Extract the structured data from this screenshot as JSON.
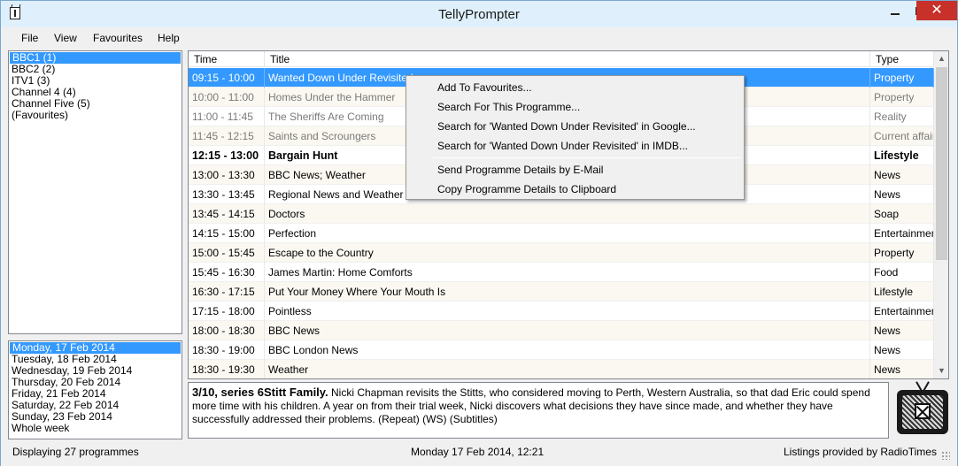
{
  "window": {
    "title": "TellyPrompter"
  },
  "menu": [
    "File",
    "View",
    "Favourites",
    "Help"
  ],
  "channels": [
    {
      "label": "BBC1 (1)",
      "selected": true
    },
    {
      "label": "BBC2 (2)",
      "selected": false
    },
    {
      "label": "ITV1 (3)",
      "selected": false
    },
    {
      "label": "Channel 4 (4)",
      "selected": false
    },
    {
      "label": "Channel Five (5)",
      "selected": false
    },
    {
      "label": "(Favourites)",
      "selected": false
    }
  ],
  "dates": [
    {
      "label": "Monday, 17 Feb 2014",
      "selected": true
    },
    {
      "label": "Tuesday, 18 Feb 2014",
      "selected": false
    },
    {
      "label": "Wednesday, 19 Feb 2014",
      "selected": false
    },
    {
      "label": "Thursday, 20 Feb 2014",
      "selected": false
    },
    {
      "label": "Friday, 21 Feb 2014",
      "selected": false
    },
    {
      "label": "Saturday, 22 Feb 2014",
      "selected": false
    },
    {
      "label": "Sunday, 23 Feb 2014",
      "selected": false
    },
    {
      "label": "Whole week",
      "selected": false
    }
  ],
  "table": {
    "headers": {
      "time": "Time",
      "title": "Title",
      "type": "Type"
    },
    "rows": [
      {
        "time": "09:15 - 10:00",
        "title": "Wanted Down Under Revisited",
        "type": "Property",
        "state": "selected"
      },
      {
        "time": "10:00 - 11:00",
        "title": "Homes Under the Hammer",
        "type": "Property",
        "state": "past"
      },
      {
        "time": "11:00 - 11:45",
        "title": "The Sheriffs Are Coming",
        "type": "Reality",
        "state": "past"
      },
      {
        "time": "11:45 - 12:15",
        "title": "Saints and Scroungers",
        "type": "Current affairs",
        "state": "past"
      },
      {
        "time": "12:15 - 13:00",
        "title": "Bargain Hunt",
        "type": "Lifestyle",
        "state": "current"
      },
      {
        "time": "13:00 - 13:30",
        "title": "BBC News; Weather",
        "type": "News",
        "state": "normal"
      },
      {
        "time": "13:30 - 13:45",
        "title": "Regional News and Weather",
        "type": "News",
        "state": "normal"
      },
      {
        "time": "13:45 - 14:15",
        "title": "Doctors",
        "type": "Soap",
        "state": "normal"
      },
      {
        "time": "14:15 - 15:00",
        "title": "Perfection",
        "type": "Entertainment",
        "state": "normal"
      },
      {
        "time": "15:00 - 15:45",
        "title": "Escape to the Country",
        "type": "Property",
        "state": "normal"
      },
      {
        "time": "15:45 - 16:30",
        "title": "James Martin: Home Comforts",
        "type": "Food",
        "state": "normal"
      },
      {
        "time": "16:30 - 17:15",
        "title": "Put Your Money Where Your Mouth Is",
        "type": "Lifestyle",
        "state": "normal"
      },
      {
        "time": "17:15 - 18:00",
        "title": "Pointless",
        "type": "Entertainment",
        "state": "normal"
      },
      {
        "time": "18:00 - 18:30",
        "title": "BBC News",
        "type": "News",
        "state": "normal"
      },
      {
        "time": "18:30 - 19:00",
        "title": "BBC London News",
        "type": "News",
        "state": "normal"
      },
      {
        "time": "18:30 - 19:30",
        "title": "Weather",
        "type": "News",
        "state": "normal"
      }
    ]
  },
  "description": {
    "heading": "3/10, series 6Stitt Family.",
    "text": " Nicki Chapman revisits the Stitts, who considered moving to Perth, Western Australia, so that dad Eric could spend more time with his children. A year on from their trial week, Nicki discovers what decisions they have since made, and whether they have successfully addressed their problems. (Repeat) (WS) (Subtitles)"
  },
  "context_menu": {
    "groups": [
      [
        "Add To Favourites...",
        "Search For This Programme...",
        "Search for 'Wanted Down Under Revisited' in Google...",
        "Search for 'Wanted Down Under Revisited' in IMDB..."
      ],
      [
        "Send Programme Details by E-Mail",
        "Copy Programme Details to Clipboard"
      ]
    ]
  },
  "status": {
    "count": "Displaying 27 programmes",
    "datetime": "Monday 17 Feb 2014, 12:21",
    "credit": "Listings provided by RadioTimes"
  },
  "colors": {
    "selection": "#3399ff",
    "titlebar": "#dff0fc",
    "close_button": "#c7312a"
  },
  "icons": {
    "app": "tv-app-icon",
    "logo": "tv-logo-icon"
  }
}
